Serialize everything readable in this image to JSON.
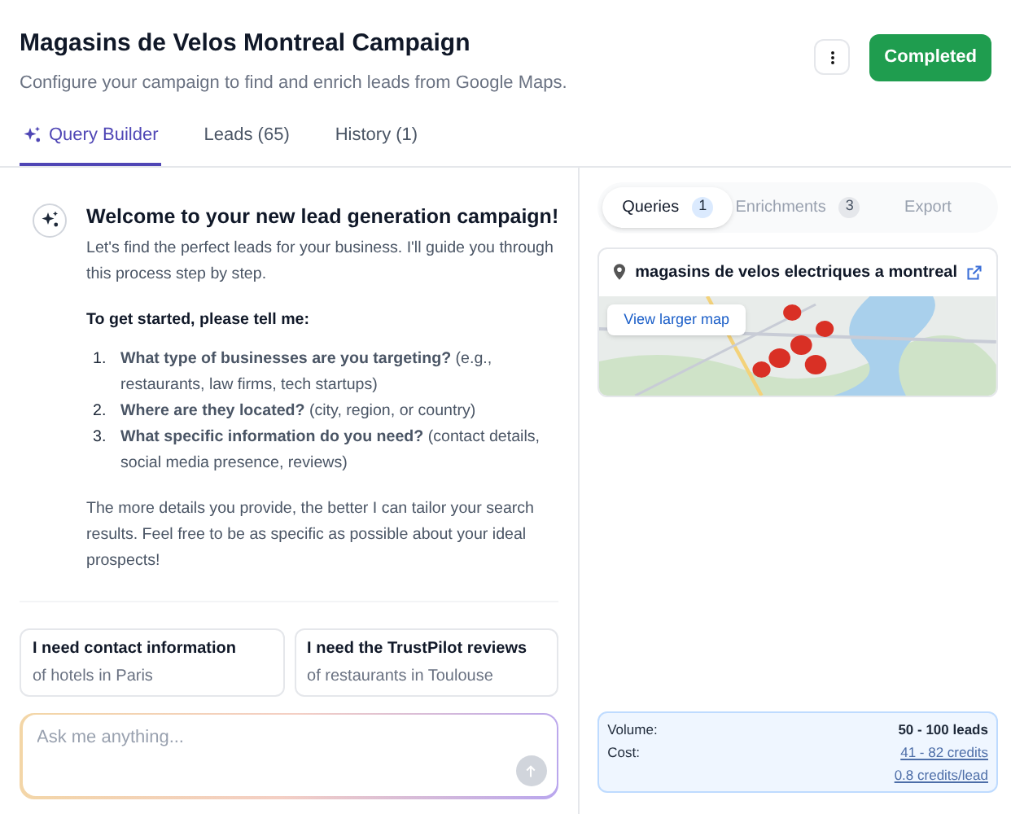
{
  "header": {
    "title": "Magasins de Velos Montreal Campaign",
    "subtitle": "Configure your campaign to find and enrich leads from Google Maps.",
    "status_button": "Completed"
  },
  "tabs": [
    {
      "label": "Query Builder",
      "selected": true,
      "icon": true
    },
    {
      "label": "Leads (65)",
      "selected": false
    },
    {
      "label": "History (1)",
      "selected": false
    }
  ],
  "welcome": {
    "title": "Welcome to your new lead generation campaign!",
    "intro": "Let's find the perfect leads for your business. I'll guide you through this process step by step.",
    "prompt": "To get started, please tell me:",
    "steps": [
      {
        "number": "1.",
        "text": "**What type of businesses are you targeting?** (e.g., restaurants, law firms, tech startups)"
      },
      {
        "number": "2.",
        "text": "**Where are they located?** (city, region, or country)"
      },
      {
        "number": "3.",
        "text": "**What specific information do you need?** (contact details, social media presence, reviews)"
      }
    ],
    "outro": "The more details you provide, the better I can tailor your search results. Feel free to be as specific as possible about your ideal prospects!"
  },
  "suggestions": [
    {
      "title": "I need contact information",
      "detail": "of hotels in Paris"
    },
    {
      "title": "I need the TrustPilot reviews",
      "detail": "of restaurants in Toulouse"
    }
  ],
  "chat_input": {
    "placeholder": "Ask me anything..."
  },
  "side_tabs": [
    {
      "label": "Queries",
      "count": "1",
      "selected": true
    },
    {
      "label": "Enrichments",
      "count": "3",
      "selected": false
    },
    {
      "label": "Export",
      "selected": false
    }
  ],
  "query": {
    "text": "magasins de velos electriques a montreal",
    "map": {
      "kind": "picture",
      "button": "View larger map"
    }
  },
  "estimate": {
    "rows": [
      {
        "label": "Volume:",
        "value": "50 - 100 leads",
        "link": false
      },
      {
        "label": "Cost:",
        "value": "41 - 82 credits",
        "link": true
      },
      {
        "value": "0.8 credits/lead",
        "link": true
      }
    ]
  }
}
